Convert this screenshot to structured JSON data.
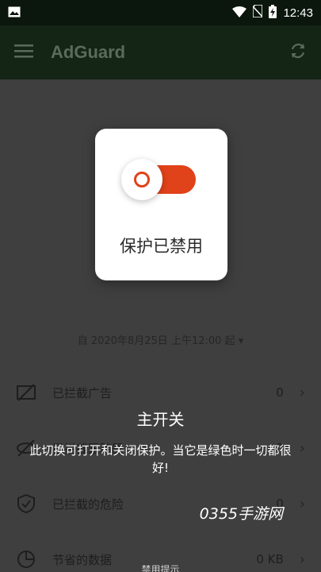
{
  "status_bar": {
    "time": "12:43"
  },
  "app_bar": {
    "title": "AdGuard"
  },
  "main": {
    "date_line": "自 2020年8月25日 上午12:00 起",
    "rows": [
      {
        "label": "已拦截广告",
        "value": "0"
      },
      {
        "label": "已拦截跟踪器",
        "value": "0"
      },
      {
        "label": "已拦截的危险",
        "value": "0"
      },
      {
        "label": "节省的数据",
        "value": "0 KB"
      }
    ]
  },
  "dialog": {
    "state_text": "保护已禁用",
    "toggle_color": "#e0421a"
  },
  "tip": {
    "title": "主开关",
    "body": "此切换可打开和关闭保护。当它是绿色时一切都很好!",
    "footer": "禁用提示"
  },
  "watermark": "0355手游网"
}
